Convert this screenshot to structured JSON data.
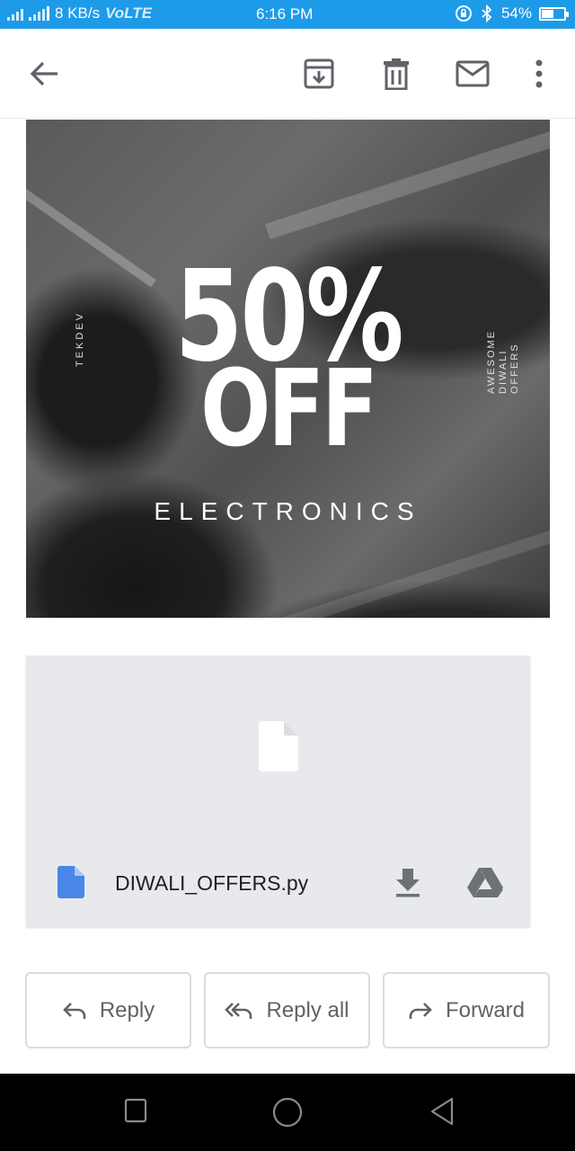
{
  "status_bar": {
    "network": "8 KB/s",
    "volte": "VoLTE",
    "time": "6:16 PM",
    "battery": "54%",
    "battery_level": 0.54
  },
  "toolbar": {
    "icons": [
      "back-arrow-icon",
      "archive-icon",
      "delete-icon",
      "mark-unread-icon",
      "more-vert-icon"
    ]
  },
  "banner": {
    "headline_1": "50%",
    "headline_2": "OFF",
    "subtitle": "ELECTRONICS",
    "side_left": "TEKDEV",
    "side_right_1": "AWESOME",
    "side_right_2": "DIWALI",
    "side_right_3": "OFFERS"
  },
  "attachment": {
    "filename": "DIWALI_OFFERS.py",
    "icons": [
      "file-icon",
      "download-icon",
      "drive-icon"
    ],
    "file_icon_color": "#4a86e8"
  },
  "actions": {
    "reply": "Reply",
    "reply_all": "Reply all",
    "forward": "Forward"
  },
  "colors": {
    "status_bar": "#1e9be8",
    "toolbar_icon": "#5f6368"
  }
}
